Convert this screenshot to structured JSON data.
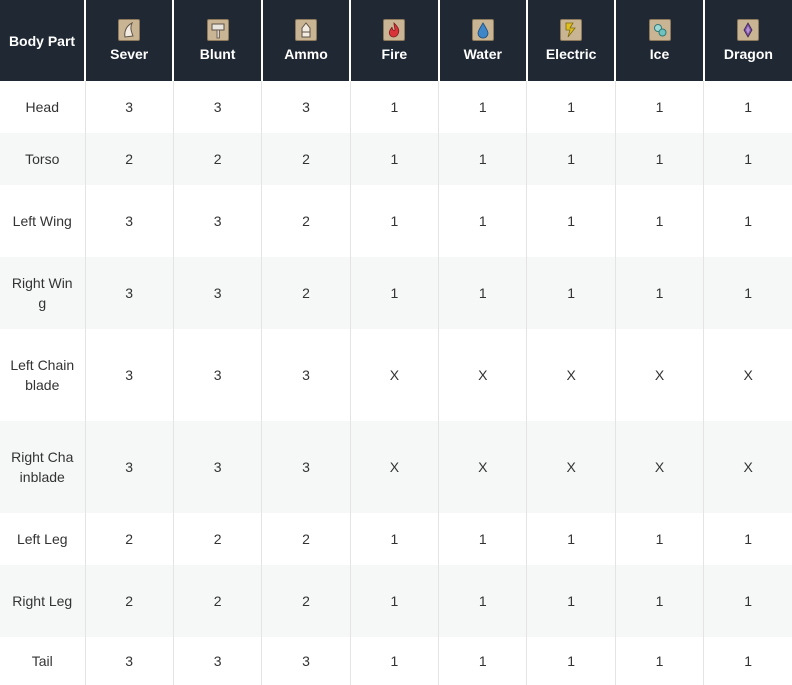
{
  "table": {
    "header": {
      "body_part": "Body Part",
      "columns": [
        {
          "label": "Sever",
          "icon": "sever-icon"
        },
        {
          "label": "Blunt",
          "icon": "blunt-icon"
        },
        {
          "label": "Ammo",
          "icon": "ammo-icon"
        },
        {
          "label": "Fire",
          "icon": "fire-icon"
        },
        {
          "label": "Water",
          "icon": "water-icon"
        },
        {
          "label": "Electric",
          "icon": "electric-icon"
        },
        {
          "label": "Ice",
          "icon": "ice-icon"
        },
        {
          "label": "Dragon",
          "icon": "dragon-icon"
        }
      ]
    },
    "rows": [
      {
        "part": "Head",
        "values": [
          "3",
          "3",
          "3",
          "1",
          "1",
          "1",
          "1",
          "1"
        ]
      },
      {
        "part": "Torso",
        "values": [
          "2",
          "2",
          "2",
          "1",
          "1",
          "1",
          "1",
          "1"
        ]
      },
      {
        "part": "Left Wing",
        "values": [
          "3",
          "3",
          "2",
          "1",
          "1",
          "1",
          "1",
          "1"
        ]
      },
      {
        "part": "Right Wing",
        "values": [
          "3",
          "3",
          "2",
          "1",
          "1",
          "1",
          "1",
          "1"
        ]
      },
      {
        "part": "Left Chainblade",
        "values": [
          "3",
          "3",
          "3",
          "X",
          "X",
          "X",
          "X",
          "X"
        ]
      },
      {
        "part": "Right Chainblade",
        "values": [
          "3",
          "3",
          "3",
          "X",
          "X",
          "X",
          "X",
          "X"
        ]
      },
      {
        "part": "Left Leg",
        "values": [
          "2",
          "2",
          "2",
          "1",
          "1",
          "1",
          "1",
          "1"
        ]
      },
      {
        "part": "Right Leg",
        "values": [
          "2",
          "2",
          "2",
          "1",
          "1",
          "1",
          "1",
          "1"
        ]
      },
      {
        "part": "Tail",
        "values": [
          "3",
          "3",
          "3",
          "1",
          "1",
          "1",
          "1",
          "1"
        ]
      }
    ]
  },
  "colors": {
    "header_bg": "#1f2833",
    "header_text": "#ffffff",
    "row_alt_bg": "#f6f8f8",
    "cell_text": "#333333",
    "icon_bg": "#c9b493"
  }
}
